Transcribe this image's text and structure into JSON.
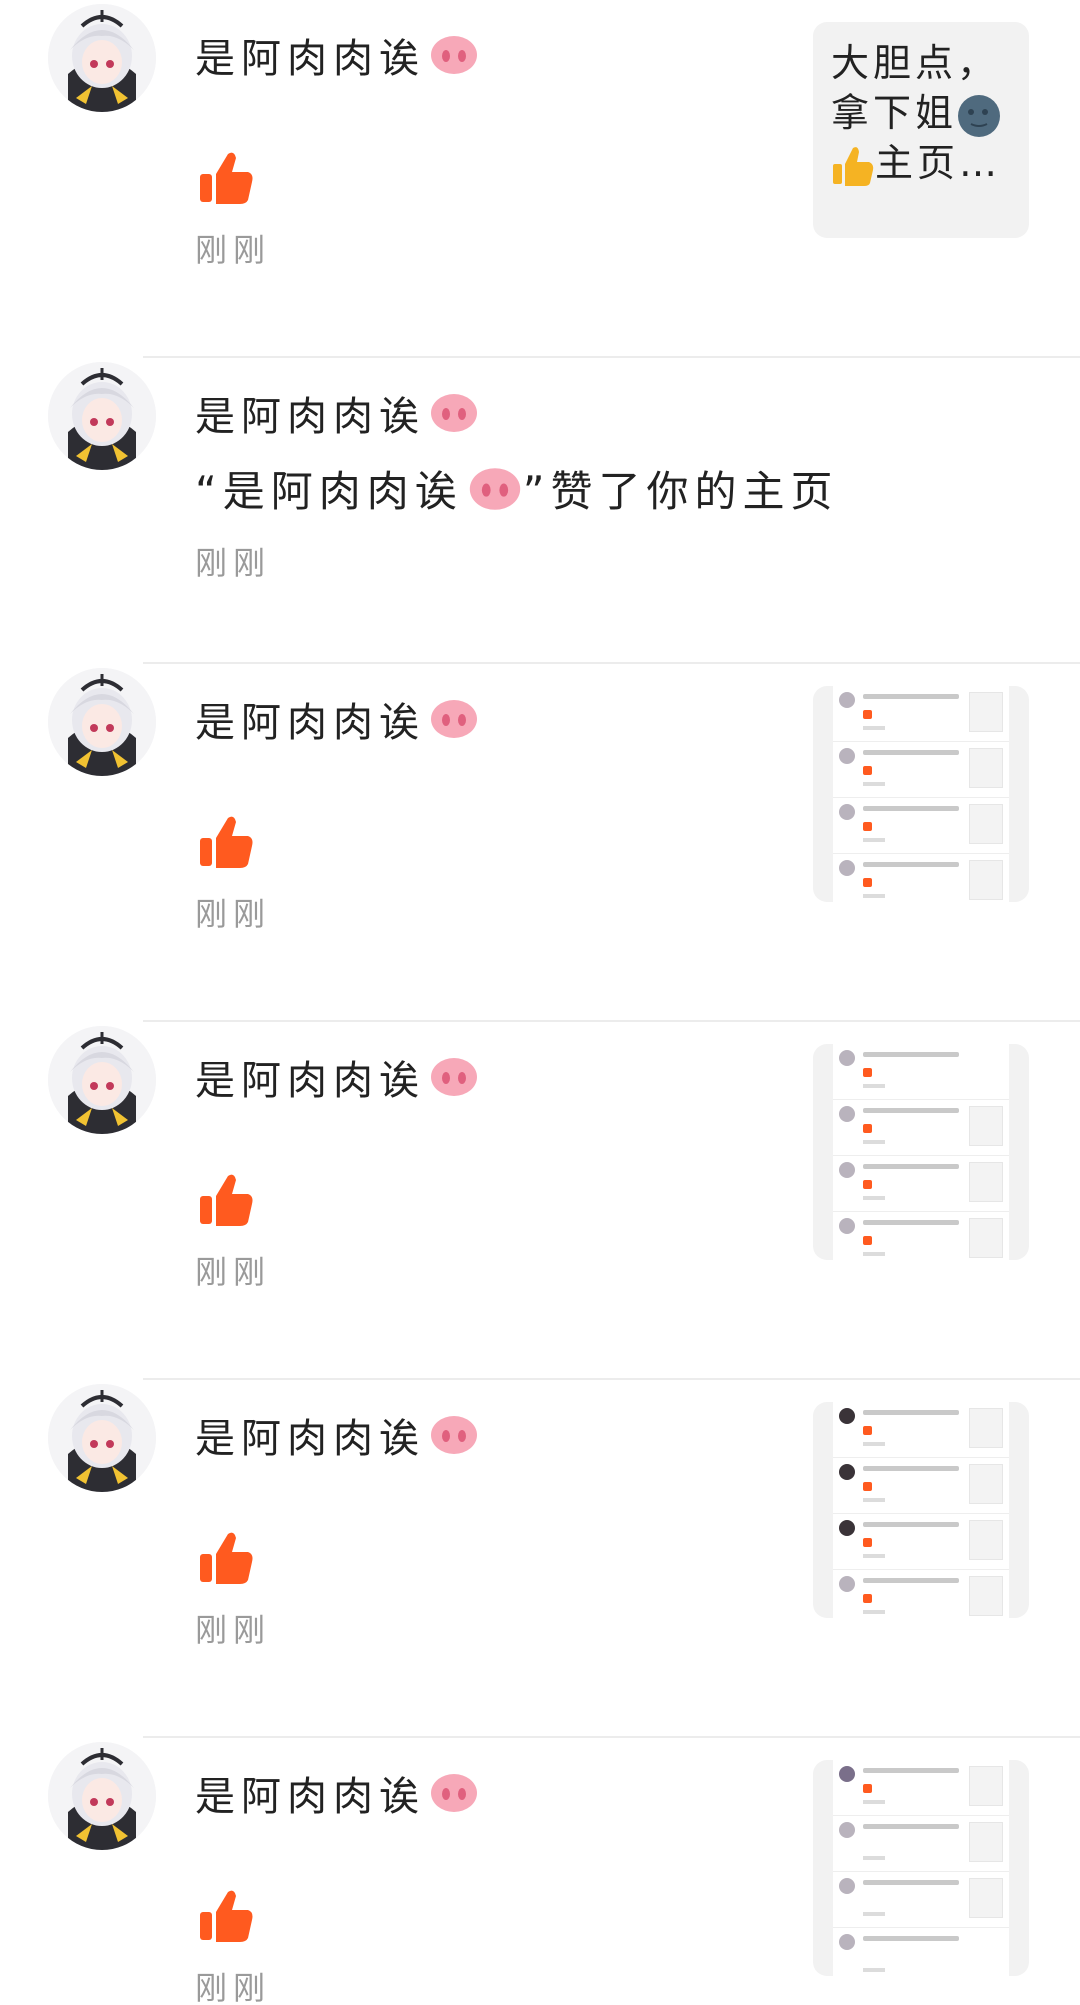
{
  "user": {
    "name": "是阿肉肉诶"
  },
  "colors": {
    "accent": "#ff5a1f",
    "nose": "#f7a8b8",
    "nose_nostril": "#e0607e",
    "time": "#9a9a9a",
    "divider": "#ececec"
  },
  "icons": {
    "like": "thumbs-up-icon",
    "nose": "pig-nose-icon",
    "moon": "moon-face-icon",
    "hand": "thumbs-up-emoji-icon"
  },
  "notifications": [
    {
      "type": "like",
      "time": "刚刚",
      "preview": {
        "kind": "text",
        "line1": "大胆点，",
        "line2": "拿下姐",
        "line3": "主页…"
      }
    },
    {
      "type": "message",
      "time": "刚刚",
      "message_prefix": "“是阿肉肉诶",
      "message_suffix": "”赞了你的主页"
    },
    {
      "type": "like",
      "time": "刚刚",
      "preview": {
        "kind": "screenshot"
      }
    },
    {
      "type": "like",
      "time": "刚刚",
      "preview": {
        "kind": "screenshot"
      }
    },
    {
      "type": "like",
      "time": "刚刚",
      "preview": {
        "kind": "screenshot"
      }
    },
    {
      "type": "like",
      "time": "刚刚",
      "preview": {
        "kind": "screenshot"
      }
    }
  ]
}
